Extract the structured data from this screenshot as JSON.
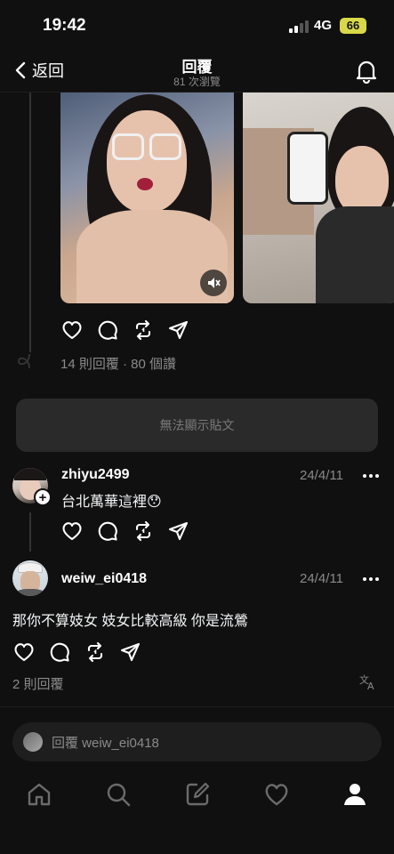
{
  "status_bar": {
    "time": "19:42",
    "network": "4G",
    "battery": "66"
  },
  "header": {
    "back_label": "返回",
    "title": "回覆",
    "subtitle": "81 次瀏覽"
  },
  "original_post": {
    "replies_views": "14 則回覆 · 80 個讚"
  },
  "blocked_post": {
    "text": "無法顯示貼文"
  },
  "replies": [
    {
      "username": "zhiyu2499",
      "date": "24/4/11",
      "text": "台北萬華這裡😯"
    },
    {
      "username": "weiw_ei0418",
      "date": "24/4/11",
      "text": "那你不算妓女 妓女比較高級 你是流鶯",
      "reply_count": "2 則回覆"
    }
  ],
  "composer": {
    "placeholder": "回覆 weiw_ei0418"
  },
  "colors": {
    "background": "#101010",
    "text": "#f3f5f7",
    "muted": "#8a8a8a",
    "battery": "#d8d84a"
  },
  "icons": [
    "chevron-left-icon",
    "bell-icon",
    "heart-icon",
    "comment-icon",
    "repost-icon",
    "share-icon",
    "mute-icon",
    "more-icon",
    "translate-icon",
    "home-icon",
    "search-icon",
    "compose-icon",
    "activity-icon",
    "profile-icon"
  ]
}
